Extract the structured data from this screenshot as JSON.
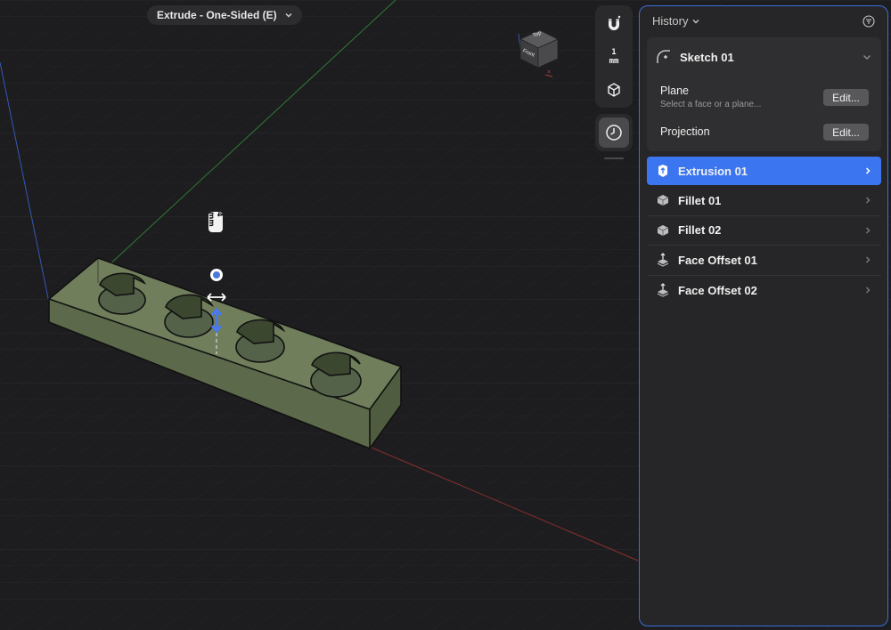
{
  "mode_pill": {
    "label": "Extrude - One-Sided (E)"
  },
  "viewport": {
    "dimension_label": "4 mm"
  },
  "nav_cube": {
    "top_label": "Top",
    "front_label": "Front"
  },
  "toolbar": {
    "unit_value": "1",
    "unit_label": "mm"
  },
  "history": {
    "title": "History",
    "sketch": {
      "label": "Sketch 01",
      "plane_label": "Plane",
      "plane_hint": "Select a face or a plane...",
      "plane_edit": "Edit...",
      "projection_label": "Projection",
      "projection_edit": "Edit..."
    },
    "features": [
      {
        "label": "Extrusion 01",
        "icon": "extrusion-icon",
        "active": true
      },
      {
        "label": "Fillet 01",
        "icon": "fillet-icon",
        "active": false
      },
      {
        "label": "Fillet 02",
        "icon": "fillet-icon",
        "active": false
      },
      {
        "label": "Face Offset 01",
        "icon": "face-offset-icon",
        "active": false
      },
      {
        "label": "Face Offset 02",
        "icon": "face-offset-icon",
        "active": false
      }
    ]
  },
  "colors": {
    "accent": "#3b76f0",
    "panel_border": "#3a6fd8",
    "body_fill": "#7d8c66"
  }
}
